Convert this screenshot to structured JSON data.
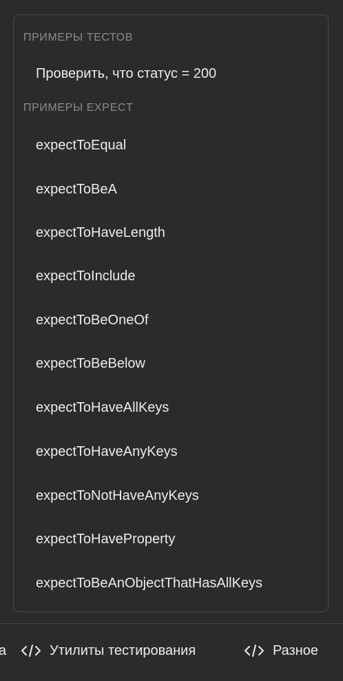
{
  "panel": {
    "tests_header": "ПРИМЕРЫ ТЕСТОВ",
    "tests": [
      "Проверить, что статус = 200"
    ],
    "expect_header": "ПРИМЕРЫ EXPECT",
    "expects": [
      "expectToEqual",
      "expectToBeA",
      "expectToHaveLength",
      "expectToInclude",
      "expectToBeOneOf",
      "expectToBeBelow",
      "expectToHaveAllKeys",
      "expectToHaveAnyKeys",
      "expectToNotHaveAnyKeys",
      "expectToHaveProperty",
      "expectToBeAnObjectThatHasAllKeys"
    ]
  },
  "bottom_bar": {
    "partial_label": "a",
    "tabs": [
      {
        "label": "Утилиты тестирования",
        "icon": "code-icon"
      },
      {
        "label": "Разное",
        "icon": "code-icon"
      }
    ]
  }
}
